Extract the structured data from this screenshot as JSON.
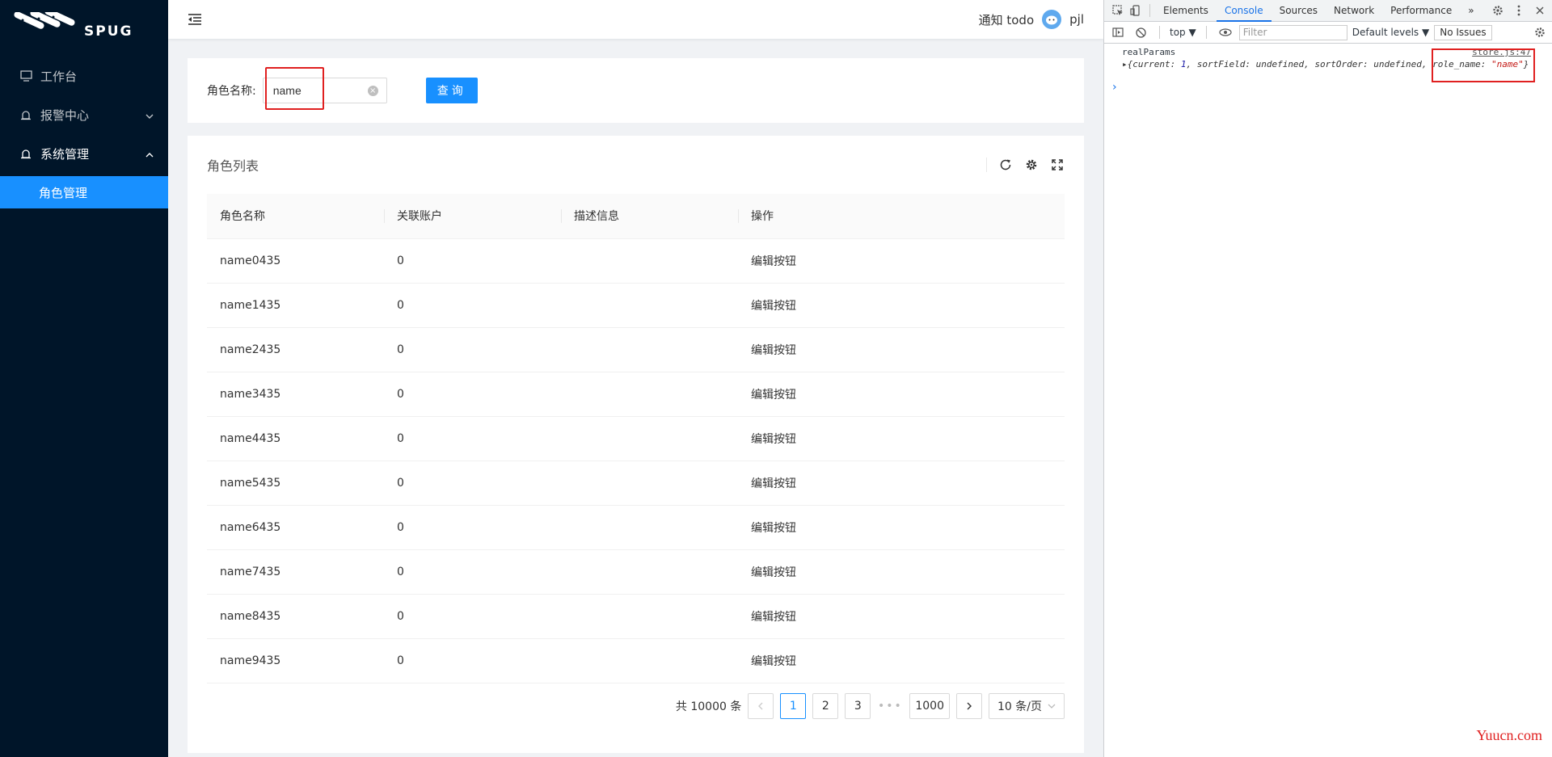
{
  "app": {
    "logo_text": "SPUG"
  },
  "sidebar": {
    "items": [
      {
        "label": "工作台"
      },
      {
        "label": "报警中心"
      },
      {
        "label": "系统管理"
      },
      {
        "label": "角色管理"
      }
    ]
  },
  "header": {
    "notice": "通知 todo",
    "username": "pjl"
  },
  "search": {
    "label": "角色名称:",
    "value": "name",
    "button": "查询"
  },
  "table": {
    "title": "角色列表",
    "columns": [
      "角色名称",
      "关联账户",
      "描述信息",
      "操作"
    ],
    "rows": [
      {
        "name": "name0435",
        "accounts": "0",
        "desc": "",
        "action": "编辑按钮"
      },
      {
        "name": "name1435",
        "accounts": "0",
        "desc": "",
        "action": "编辑按钮"
      },
      {
        "name": "name2435",
        "accounts": "0",
        "desc": "",
        "action": "编辑按钮"
      },
      {
        "name": "name3435",
        "accounts": "0",
        "desc": "",
        "action": "编辑按钮"
      },
      {
        "name": "name4435",
        "accounts": "0",
        "desc": "",
        "action": "编辑按钮"
      },
      {
        "name": "name5435",
        "accounts": "0",
        "desc": "",
        "action": "编辑按钮"
      },
      {
        "name": "name6435",
        "accounts": "0",
        "desc": "",
        "action": "编辑按钮"
      },
      {
        "name": "name7435",
        "accounts": "0",
        "desc": "",
        "action": "编辑按钮"
      },
      {
        "name": "name8435",
        "accounts": "0",
        "desc": "",
        "action": "编辑按钮"
      },
      {
        "name": "name9435",
        "accounts": "0",
        "desc": "",
        "action": "编辑按钮"
      }
    ]
  },
  "pagination": {
    "total": "共 10000 条",
    "pages": [
      "1",
      "2",
      "3"
    ],
    "ellipsis": "•••",
    "last": "1000",
    "page_size": "10 条/页"
  },
  "devtools": {
    "tabs": [
      "Elements",
      "Console",
      "Sources",
      "Network",
      "Performance"
    ],
    "more": "»",
    "context": "top ▼",
    "filter_placeholder": "Filter",
    "levels": "Default levels ▼",
    "issues": "No Issues",
    "log_label": "realParams",
    "log_source": "store.js:47",
    "obj_prefix": "{current: ",
    "obj_current": "1",
    "obj_middle": ", sortField: undefined, sortOrder: undefined, role_name: ",
    "obj_role": "\"name\"",
    "obj_suffix": "}"
  },
  "watermark": "Yuucn.com",
  "colors": {
    "primary": "#1890ff",
    "sidebar_bg": "#001529",
    "highlight": "#e02020"
  }
}
